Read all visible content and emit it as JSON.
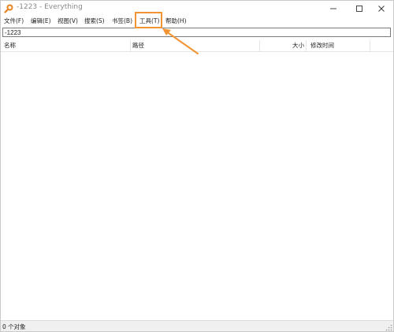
{
  "window": {
    "title": "-1223 - Everything",
    "minimize_glyph": "—",
    "maximize_glyph": "☐",
    "close_glyph": "✕"
  },
  "menu": {
    "items": [
      {
        "label": "文件(F)"
      },
      {
        "label": "编辑(E)"
      },
      {
        "label": "视图(V)"
      },
      {
        "label": "搜索(S)"
      },
      {
        "label": "书签(B)"
      },
      {
        "label": "工具(T)"
      },
      {
        "label": "帮助(H)"
      }
    ]
  },
  "search": {
    "value": "-1223"
  },
  "columns": {
    "name": "名称",
    "path": "路径",
    "size": "大小",
    "modified": "修改时间"
  },
  "status": {
    "text": "0 个对象"
  },
  "colors": {
    "annotation": "#f19431",
    "icon_orange": "#e8821c"
  },
  "icons": {
    "app": "magnifier-icon",
    "annotation": "arrow-icon"
  }
}
